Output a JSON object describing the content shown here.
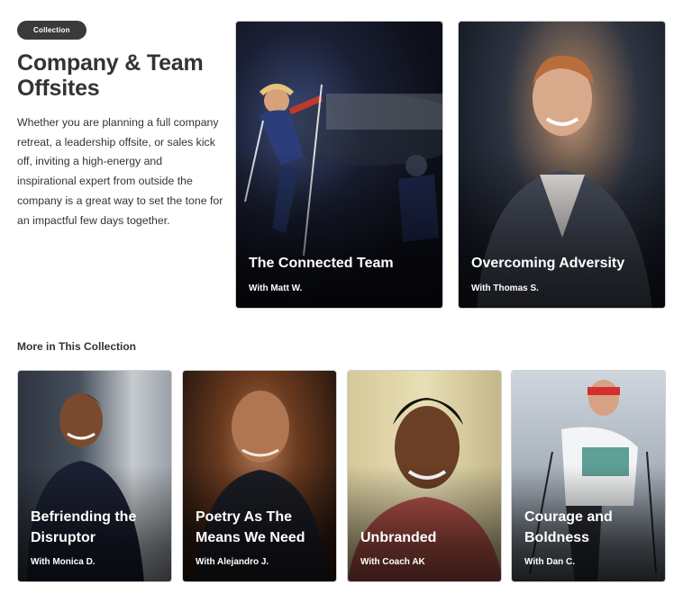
{
  "collection_badge": "Collection",
  "title": "Company & Team Offsites",
  "description": "Whether you are planning a full company retreat, a leadership offsite, or sales kick off, inviting a high-energy and inspirational expert from outside the company is a great way to set the tone for an impactful few days together.",
  "featured": [
    {
      "title": "The Connected Team",
      "byline": "With Matt W."
    },
    {
      "title": "Overcoming Adversity",
      "byline": "With Thomas S."
    }
  ],
  "more_label": "More in This Collection",
  "more": [
    {
      "title": "Befriending the Disruptor",
      "byline": "With Monica D."
    },
    {
      "title": "Poetry As The Means We Need",
      "byline": "With Alejandro J."
    },
    {
      "title": "Unbranded",
      "byline": "With Coach AK"
    },
    {
      "title": "Courage and Boldness",
      "byline": "With Dan C."
    }
  ]
}
